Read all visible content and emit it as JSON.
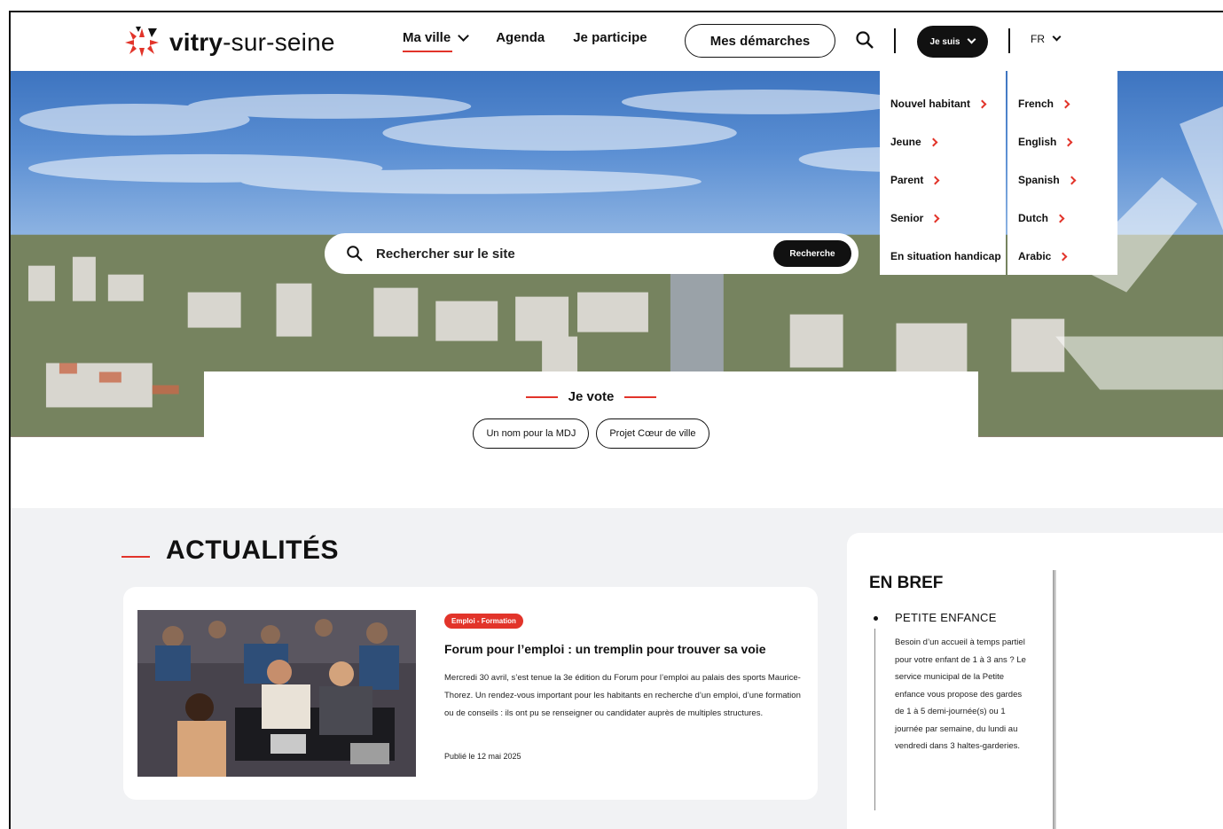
{
  "header": {
    "logo_bold": "vitry",
    "logo_rest": "-sur-seine",
    "nav": [
      {
        "label": "Ma ville"
      },
      {
        "label": "Agenda"
      },
      {
        "label": "Je participe"
      }
    ],
    "demarches_label": "Mes démarches",
    "je_suis_label": "Je suis",
    "lang_label": "FR"
  },
  "dropdown_profiles": [
    "Nouvel habitant",
    "Jeune",
    "Parent",
    "Senior",
    "En situation handicap"
  ],
  "dropdown_languages": [
    "French",
    "English",
    "Spanish",
    "Dutch",
    "Arabic"
  ],
  "hero": {
    "search_placeholder": "Rechercher sur le site",
    "search_button": "Recherche"
  },
  "vote": {
    "title": "Je vote",
    "buttons": [
      "Un nom pour la MDJ",
      "Projet Cœur de ville"
    ]
  },
  "news": {
    "section_title": "ACTUALITÉS",
    "card": {
      "tag": "Emploi - Formation",
      "title": "Forum pour l’emploi : un tremplin pour trouver sa voie",
      "text": "Mercredi 30 avril, s’est tenue la 3e édition du Forum pour l’emploi au palais des sports Maurice-Thorez. Un rendez-vous important pour les habitants en recherche d’un emploi, d’une formation ou de conseils : ils ont pu se renseigner ou candidater auprès de multiples structures.",
      "date": "Publié le 12 mai 2025"
    }
  },
  "bref": {
    "title": "EN BREF",
    "item_title": "PETITE ENFANCE",
    "item_text": "Besoin d’un accueil à temps partiel pour votre enfant de 1 à 3 ans ? Le service municipal de la Petite enfance vous propose des gardes de 1 à 5 demi-journée(s) ou 1 journée par semaine, du lundi au vendredi dans 3 haltes-garderies."
  },
  "colors": {
    "accent": "#e2342a",
    "dark": "#111111",
    "section_bg": "#f1f2f4"
  }
}
